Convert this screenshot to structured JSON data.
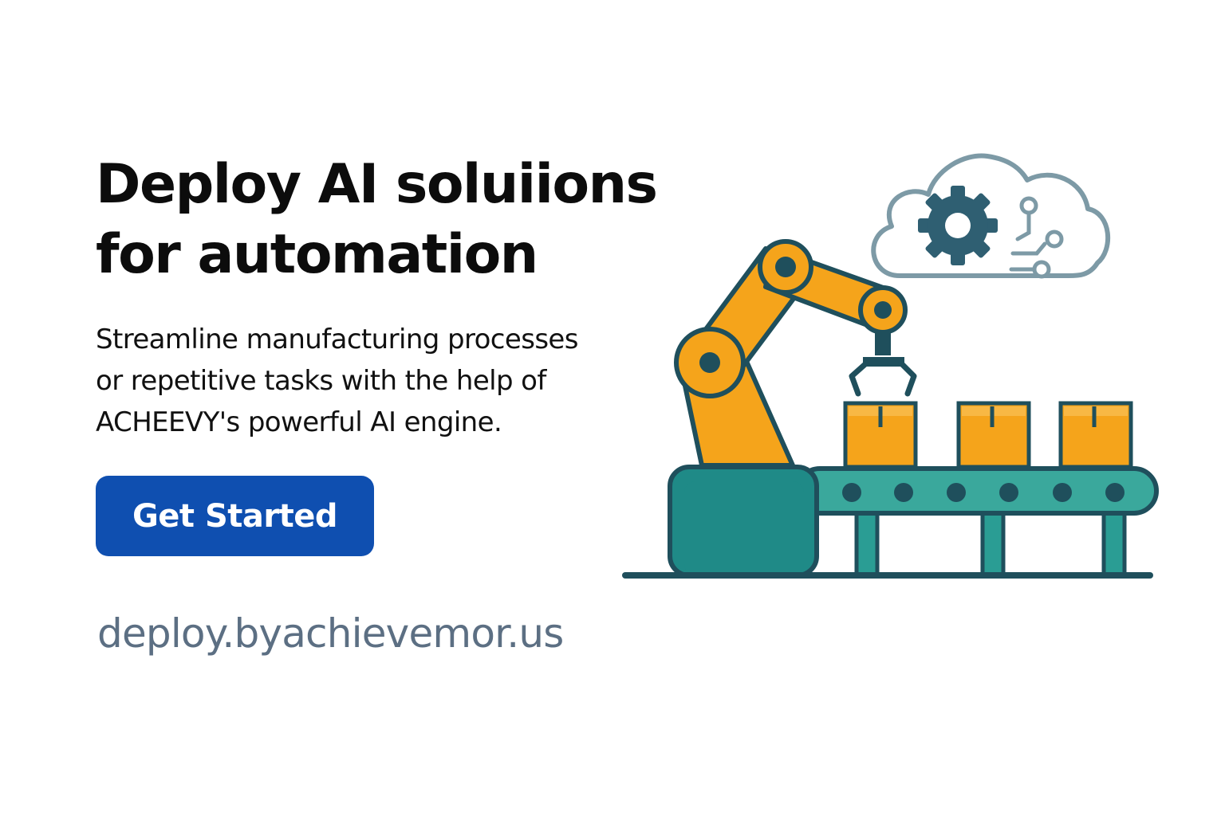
{
  "hero": {
    "headline_line1": "Deploy AI soluiions",
    "headline_line2": "for automation",
    "subtext_line1": "Streamline manufacturing processes",
    "subtext_line2": "or repetitive tasks with the help of",
    "subtext_line3": "ACHEEVY's powerful AI engine.",
    "cta_label": "Get Started",
    "domain": "deploy.byachievemor.us"
  },
  "illustration": {
    "icons": [
      "robot-arm-icon",
      "conveyor-belt-icon",
      "cardboard-box-icon",
      "cloud-icon",
      "gear-icon",
      "circuit-node-icon"
    ]
  },
  "colors": {
    "cta_background": "#0f4fb0",
    "headline": "#0c0c0c",
    "domain_text": "#5c6f83",
    "robot_orange": "#f5a41b",
    "conveyor_teal": "#2a9d94",
    "outline_dark": "#1f4f5c",
    "cloud_outline": "#7d9aa6"
  }
}
